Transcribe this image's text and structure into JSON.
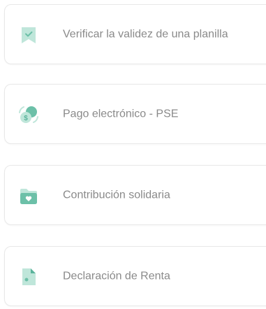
{
  "colors": {
    "accent": "#7ec9b5",
    "accent_dark": "#5ab39b",
    "accent_light": "#bfe6da",
    "text": "#8a8a8a",
    "border": "#e8e8e8"
  },
  "services": [
    {
      "label": "Verificar la validez de una planilla",
      "icon": "bookmark-check-icon"
    },
    {
      "label": "Pago electrónico - PSE",
      "icon": "money-exchange-icon"
    },
    {
      "label": "Contribución solidaria",
      "icon": "folder-heart-icon"
    },
    {
      "label": "Declaración de Renta",
      "icon": "document-icon"
    }
  ]
}
